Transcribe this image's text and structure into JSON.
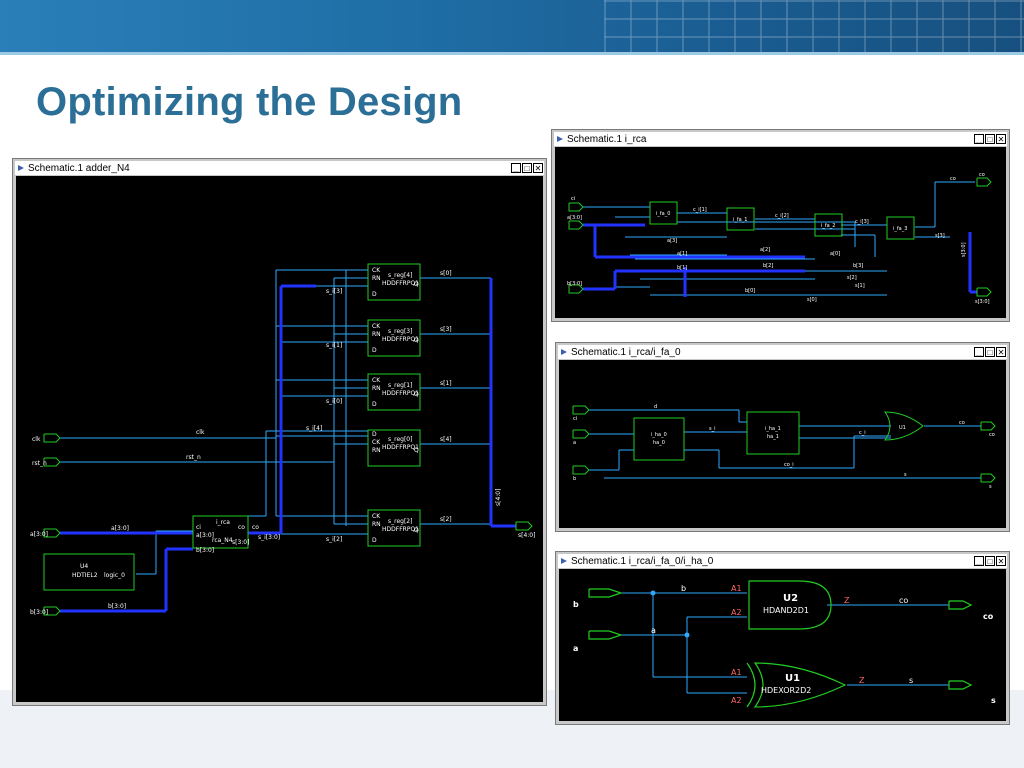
{
  "slide": {
    "title": "Optimizing the Design"
  },
  "windows": {
    "w1": {
      "title": "Schematic.1    adder_N4",
      "btn_min": "▁",
      "btn_max": "□",
      "btn_close": "✕"
    },
    "w2": {
      "title": "Schematic.1    i_rca",
      "btn_min": "▁",
      "btn_max": "□",
      "btn_close": "✕"
    },
    "w3": {
      "title": "Schematic.1    i_rca/i_fa_0",
      "btn_min": "▁",
      "btn_max": "□",
      "btn_close": "✕"
    },
    "w4": {
      "title": "Schematic.1    i_rca/i_fa_0/i_ha_0",
      "btn_min": "▁",
      "btn_max": "□",
      "btn_close": "✕"
    }
  },
  "adder": {
    "ports": {
      "clk": "clk",
      "rst_n": "rst_n",
      "a": "a[3:0]",
      "b": "b[3:0]",
      "s": "s[4:0]"
    },
    "nets": {
      "clk": "clk",
      "rst_n": "rst_n",
      "a": "a[3:0]",
      "b": "b[3:0]",
      "s_int": "s_i[3:0]",
      "s_bus": "s[4:0]",
      "co": "co",
      "s_i4": "s_i[4]",
      "s_i3": "s_i[3]",
      "s_i2": "s_i[2]",
      "s_i1": "s_i[1]",
      "s_i0": "s_i[0]",
      "so4": "s[4]",
      "so3": "s[3]",
      "so2": "s[2]",
      "so1": "s[1]",
      "so0": "s[0]"
    },
    "flops": [
      {
        "inst": "s_reg[4]",
        "cell": "HDDFFRPQ1"
      },
      {
        "inst": "s_reg[3]",
        "cell": "HDDFFRPQ1"
      },
      {
        "inst": "s_reg[1]",
        "cell": "HDDFFRPQ1"
      },
      {
        "inst": "s_reg[0]",
        "cell": "HDDFFRPQ1"
      },
      {
        "inst": "s_reg[2]",
        "cell": "HDDFFRPQ1"
      }
    ],
    "flop_pins": {
      "ck": "CK",
      "rn": "RN",
      "d": "D",
      "q": "Q"
    },
    "rca": {
      "inst": "i_rca",
      "cell": "rca_N4",
      "pin_ci": "ci",
      "pin_a": "a[3:0]",
      "pin_b": "b[3:0]",
      "pin_co": "co",
      "pin_s": "s[3:0]"
    },
    "tie": {
      "inst": "U4",
      "cell": "HDTIEL2",
      "net": "logic_0"
    }
  },
  "rca": {
    "ports": {
      "ci": "ci",
      "a": "a[3:0]",
      "b": "b[3:0]",
      "co": "co",
      "s": "s[3:0]"
    },
    "blocks": [
      "i_fa_0",
      "i_fa_1",
      "i_fa_2",
      "i_fa_3"
    ],
    "nets": {
      "c1": "c_i[1]",
      "c2": "c_i[2]",
      "c3": "c_i[3]",
      "co": "co",
      "a3": "a[3]",
      "a2": "a[2]",
      "a1": "a[1]",
      "a0": "a[0]",
      "b3": "b[3]",
      "b2": "b[2]",
      "b1": "b[1]",
      "b0": "b[0]",
      "s3": "s[3]",
      "s2": "s[2]",
      "s1": "s[1]",
      "s0": "s[0]",
      "sbus": "s[3:0]"
    }
  },
  "fa": {
    "ports": {
      "ci": "ci",
      "a": "a",
      "b": "b",
      "co": "co",
      "s": "s"
    },
    "ha0": {
      "inst": "i_ha_0",
      "cell": "ha_0"
    },
    "ha1": {
      "inst": "i_ha_1",
      "cell": "ha_1"
    },
    "or": {
      "inst": "U1"
    },
    "nets": {
      "s_i": "s_i",
      "c_i": "c_i",
      "co_i": "co_i",
      "s": "s",
      "co": "co",
      "d": "d"
    }
  },
  "ha": {
    "ports": {
      "a": "a",
      "b": "b",
      "co": "co",
      "s": "s"
    },
    "and": {
      "inst": "U2",
      "cell": "HDAND2D1",
      "a1": "A1",
      "a2": "A2",
      "z": "Z"
    },
    "xor": {
      "inst": "U1",
      "cell": "HDEXOR2D2",
      "a1": "A1",
      "a2": "A2",
      "z": "Z"
    },
    "nets": {
      "b": "b",
      "a": "a",
      "co": "co",
      "s": "s"
    }
  },
  "colors": {
    "wire": "#2fa8ff",
    "bus": "#2233ff",
    "cell": "#22cc22",
    "label": "#ffffff",
    "title": "#2b6f97"
  }
}
